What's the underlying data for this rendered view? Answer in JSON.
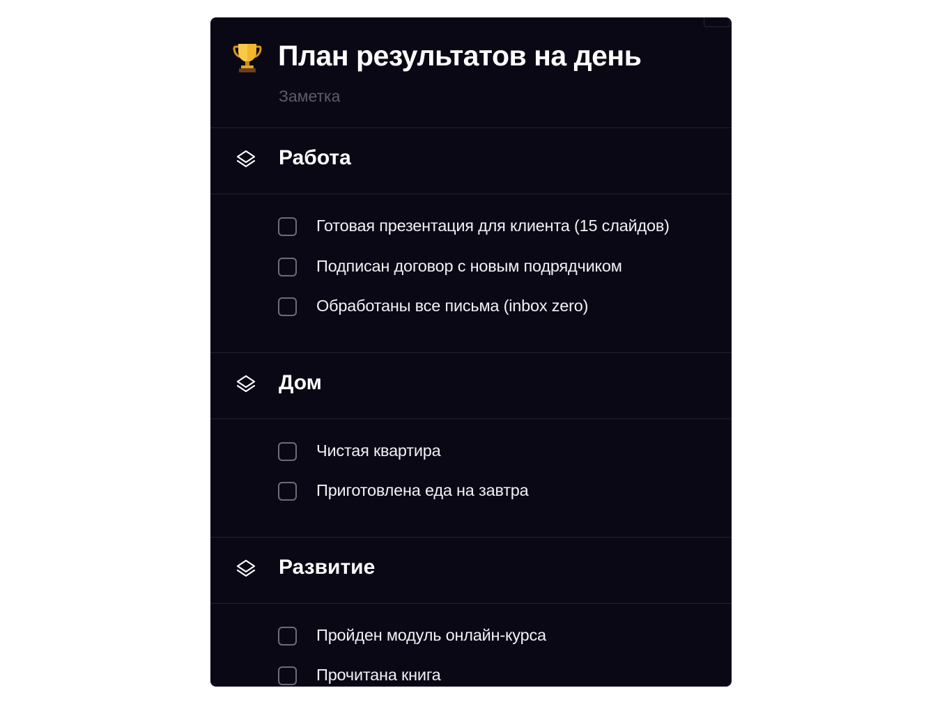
{
  "note": {
    "icon": "trophy-icon",
    "title": "План результатов на день",
    "subtitle": "Заметка"
  },
  "sections": [
    {
      "icon": "layers-icon",
      "title": "Работа",
      "items": [
        {
          "label": "Готовая презентация для клиента (15 слайдов)",
          "checked": false
        },
        {
          "label": "Подписан договор с новым подрядчиком",
          "checked": false
        },
        {
          "label": "Обработаны все письма (inbox zero)",
          "checked": false
        }
      ]
    },
    {
      "icon": "layers-icon",
      "title": "Дом",
      "items": [
        {
          "label": "Чистая квартира",
          "checked": false
        },
        {
          "label": "Приготовлена еда на завтра",
          "checked": false
        }
      ]
    },
    {
      "icon": "layers-icon",
      "title": "Развитие",
      "items": [
        {
          "label": "Пройден модуль онлайн-курса",
          "checked": false
        },
        {
          "label": "Прочитана книга",
          "checked": false
        }
      ]
    }
  ],
  "colors": {
    "card_background": "#0b0815",
    "divider": "#24212e",
    "text_primary": "#ffffff",
    "text_muted": "#5e5b6a",
    "checkbox_border": "#6f6b7a"
  }
}
